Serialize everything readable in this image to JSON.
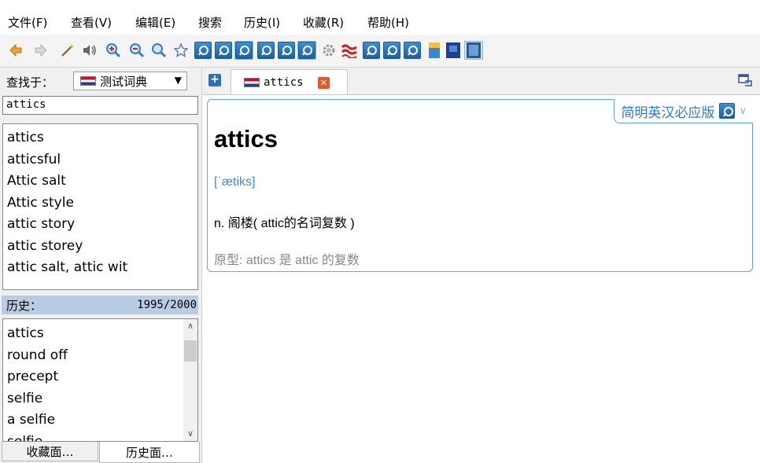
{
  "menu": {
    "items": [
      "文件(F)",
      "查看(V)",
      "编辑(E)",
      "搜索",
      "历史(I)",
      "收藏(R)",
      "帮助(H)"
    ]
  },
  "toolbar": {
    "icons": [
      "back-icon",
      "forward-icon",
      "wand-icon",
      "speaker-icon",
      "zoom-in-icon",
      "zoom-out-icon",
      "zoom-reset-icon",
      "star-icon",
      "dictionary-icon",
      "dictionary-icon",
      "dictionary-icon",
      "dictionary-icon",
      "dictionary-icon",
      "dictionary-icon",
      "gear-icon",
      "wave-icon",
      "dictionary-icon",
      "dictionary-icon",
      "dictionary-icon",
      "book-icon",
      "book-icon",
      "book-icon"
    ]
  },
  "left": {
    "lookin_label": "查找于：",
    "dict_select": "测试词典",
    "search_value": "attics",
    "word_list": [
      "attics",
      "atticsful",
      "Attic salt",
      "Attic style",
      "attic story",
      "attic storey",
      "attic salt, attic wit"
    ],
    "history_label": "历史：",
    "history_count": "1995/2000",
    "history_list": [
      "attics",
      "round off",
      "precept",
      "selfie",
      "a selfie",
      "selfie"
    ],
    "tabs": {
      "favorites": "收藏面…",
      "history": "历史面…"
    }
  },
  "right": {
    "tab_label": "attics",
    "dict_name": "简明英汉必应版",
    "headword": "attics",
    "phonetic": "[ˈætiks]",
    "definition": "n. 阁楼( attic的名词复数 )",
    "origin": "原型: attics 是 attic 的复数"
  },
  "colors": {
    "accent": "#5aa9e6",
    "phonetic": "#3a8ee6",
    "history_header": "#b8cde3"
  }
}
